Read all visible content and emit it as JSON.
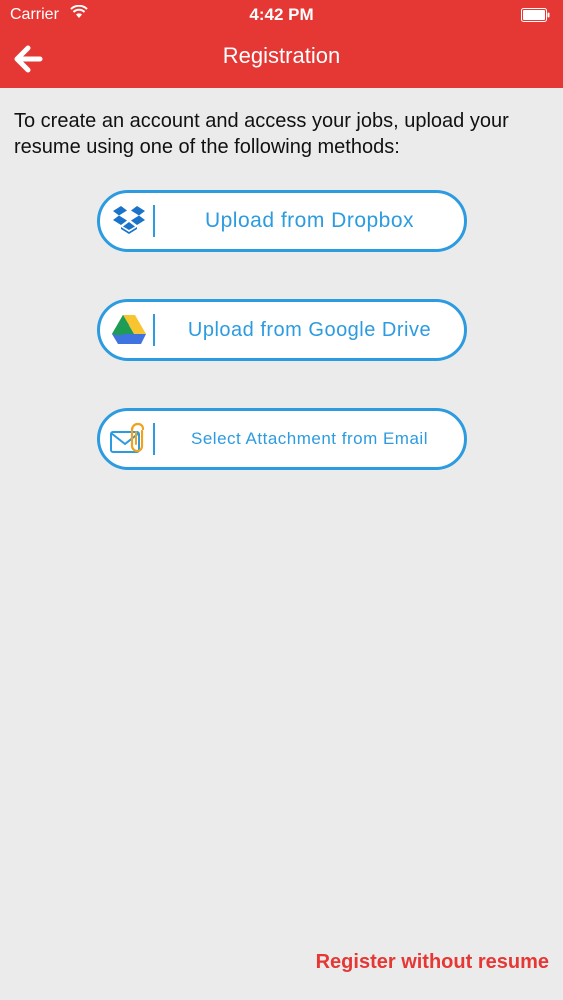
{
  "status_bar": {
    "carrier": "Carrier",
    "time": "4:42 PM"
  },
  "nav": {
    "title": "Registration",
    "back_icon": "arrow-left-icon"
  },
  "intro": {
    "text": "To create an account and access your jobs, upload your resume using one of the following methods:"
  },
  "upload_options": [
    {
      "label": "Upload from Dropbox",
      "icon": "dropbox-icon"
    },
    {
      "label": "Upload from Google Drive",
      "icon": "google-drive-icon"
    },
    {
      "label": "Select Attachment from Email",
      "icon": "email-attachment-icon"
    }
  ],
  "footer": {
    "register_without_resume": "Register without resume"
  },
  "colors": {
    "header": "#e53835",
    "accent_blue": "#2c9be0",
    "background": "#ebebeb",
    "link_red": "#e53835"
  }
}
